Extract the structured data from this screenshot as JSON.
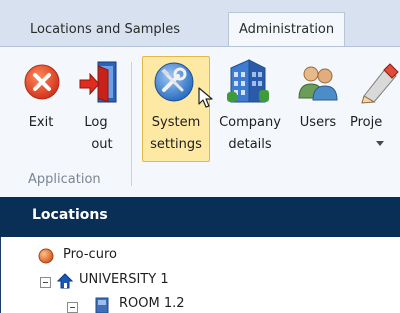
{
  "tabs": [
    {
      "label": "Locations and Samples"
    },
    {
      "label": "Administration"
    }
  ],
  "ribbon": {
    "exit_label": "Exit",
    "logout_line1": "Log",
    "logout_line2": "out",
    "system_line1": "System",
    "system_line2": "settings",
    "company_line1": "Company",
    "company_line2": "details",
    "users_label": "Users",
    "projects_label": "Proje",
    "group_label": "Application"
  },
  "locations": {
    "title": "Locations",
    "tree": [
      {
        "label": "Pro-curo"
      },
      {
        "label": "UNIVERSITY 1"
      },
      {
        "label": "ROOM 1.2"
      }
    ]
  }
}
